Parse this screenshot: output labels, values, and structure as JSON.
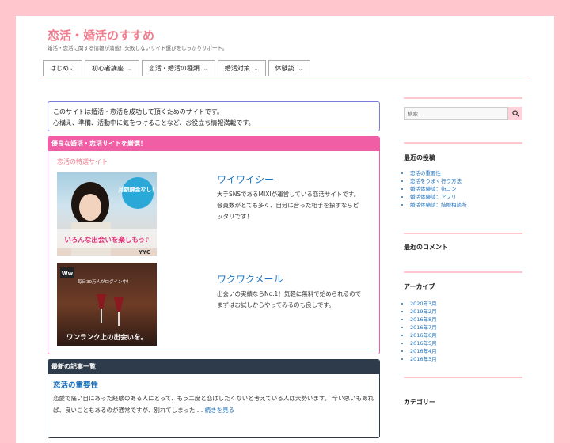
{
  "site": {
    "title": "恋活・婚活のすすめ",
    "tagline": "婚活・恋活に関する情報が満載！失敗しないサイト選びをしっかりサポート。"
  },
  "nav": [
    {
      "label": "はじめに",
      "dropdown": false
    },
    {
      "label": "初心者講座",
      "dropdown": true
    },
    {
      "label": "恋活・婚活の種類",
      "dropdown": true
    },
    {
      "label": "婚活対策",
      "dropdown": true
    },
    {
      "label": "体験談",
      "dropdown": true
    }
  ],
  "intro": {
    "line1": "このサイトは婚活・恋活を成功して頂くためのサイトです。",
    "line2": "心構え、準備、活動中に気をつけることなど、お役立ち情報満載です。"
  },
  "featured": {
    "heading": "優良な婚活・恋活サイトを厳選！",
    "subheading": "恋活の特選サイト",
    "sites": [
      {
        "name": "ワイワイシー",
        "desc1": "大手SNSであるMIXIが運営している恋活サイトです。",
        "desc2": "会員数がとても多く、自分に合った相手を探すならピ",
        "desc3": "ッタリです！",
        "banner_badge": "月額課金なし！",
        "banner_text": "いろんな出会いを楽しもう♪",
        "banner_logo": "YYC"
      },
      {
        "name": "ワクワクメール",
        "desc1": "出会いの実績ならNo.1！気軽に無料で始められるので",
        "desc2": "まずはお試しからやってみるのも良しです。",
        "desc3": "",
        "banner_badge": "毎日30万人がログイン中！",
        "banner_text": "ワンランク上の出会いを。",
        "banner_logo": "Ww"
      }
    ]
  },
  "latest": {
    "heading": "最新の記事一覧",
    "post_title": "恋活の重要性",
    "excerpt": "恋愛で痛い目にあった経験のある人にとって、もう二度と恋はしたくないと考えている人は大勢います。 辛い思いもあれば、良いこともあるのが通常ですが、別れてしまった …",
    "more": "続きを見る"
  },
  "sidebar": {
    "search_placeholder": "検索 …",
    "recent_posts_title": "最近の投稿",
    "recent_posts": [
      "恋活の重要性",
      "恋活をうまく行う方法",
      "婚活体験談：街コン",
      "婚活体験談：アプリ",
      "婚活体験談：結婚相談所"
    ],
    "recent_comments_title": "最近のコメント",
    "archives_title": "アーカイブ",
    "archives": [
      "2020年3月",
      "2019年2月",
      "2016年8月",
      "2016年7月",
      "2016年6月",
      "2016年5月",
      "2016年4月",
      "2016年3月"
    ],
    "categories_title": "カテゴリー"
  },
  "colors": {
    "background": "#ffc6cd",
    "title": "#f07c8e",
    "link": "#1e73be",
    "featured_head": "#f05fa6",
    "latest_head": "#2e3b4a"
  }
}
